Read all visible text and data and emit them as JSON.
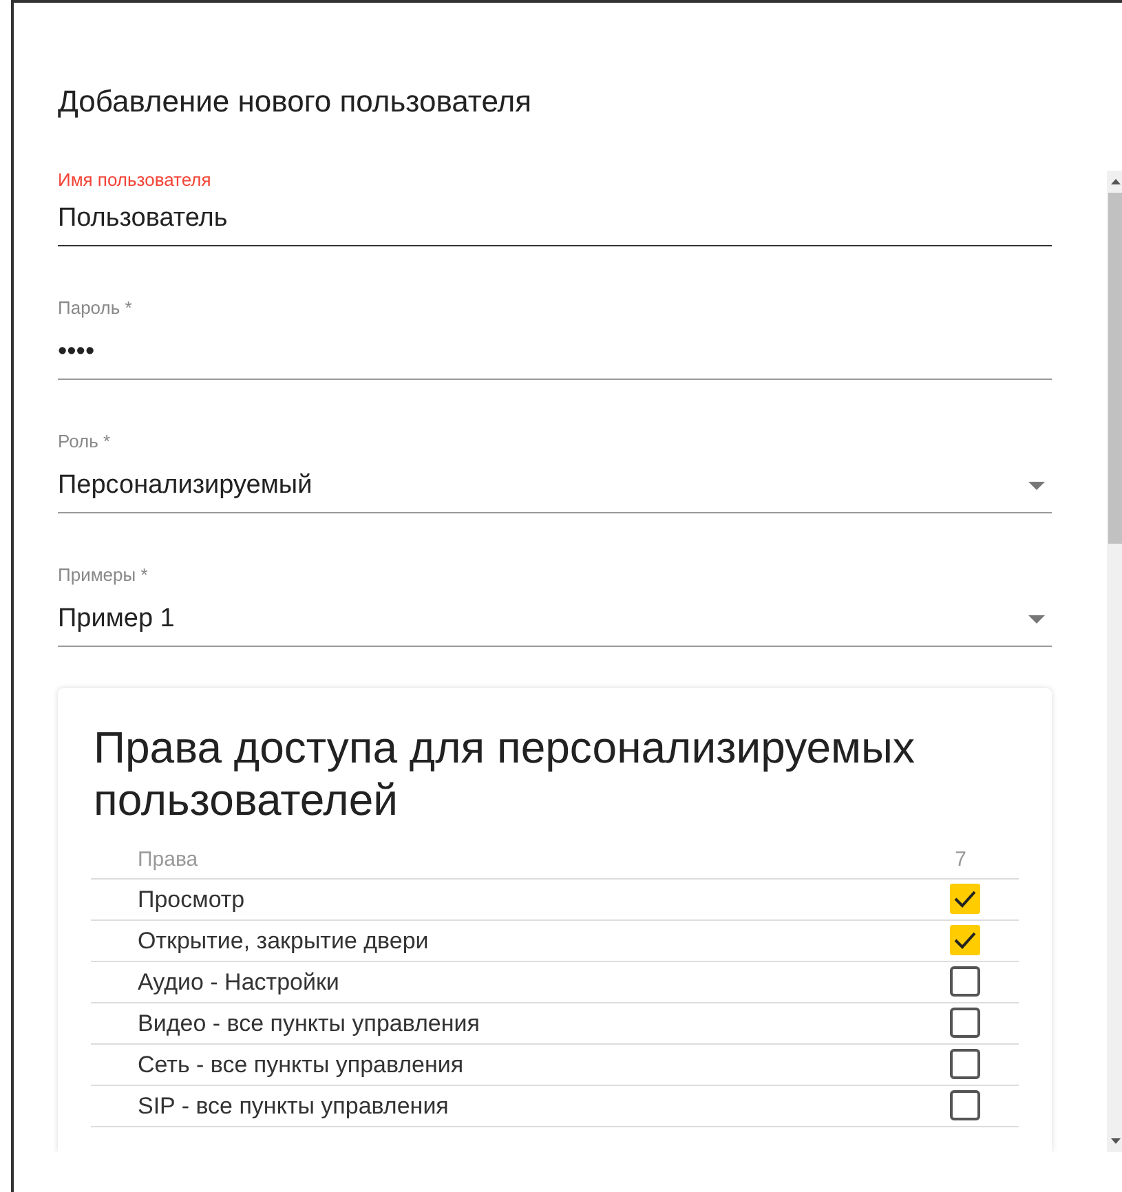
{
  "dialog": {
    "title": "Добавление нового пользователя"
  },
  "fields": [
    {
      "kind": "text",
      "label": "Имя пользователя",
      "value": "Пользователь",
      "focused": true
    },
    {
      "kind": "password",
      "label": "Пароль *",
      "value": "••••",
      "focused": false
    },
    {
      "kind": "select",
      "label": "Роль *",
      "value": "Персонализируемый",
      "focused": false
    },
    {
      "kind": "select",
      "label": "Примеры *",
      "value": "Пример 1",
      "focused": false
    }
  ],
  "permissions": {
    "title": "Права доступа для персонализируемых пользователей",
    "columns": [
      "Права",
      "7"
    ],
    "rows": [
      {
        "label": "Просмотр",
        "checked": true
      },
      {
        "label": "Открытие, закрытие двери",
        "checked": true
      },
      {
        "label": "Аудио - Настройки",
        "checked": false
      },
      {
        "label": "Видео - все пункты управления",
        "checked": false
      },
      {
        "label": "Сеть - все пункты управления",
        "checked": false
      },
      {
        "label": "SIP - все пункты управления",
        "checked": false
      }
    ]
  }
}
